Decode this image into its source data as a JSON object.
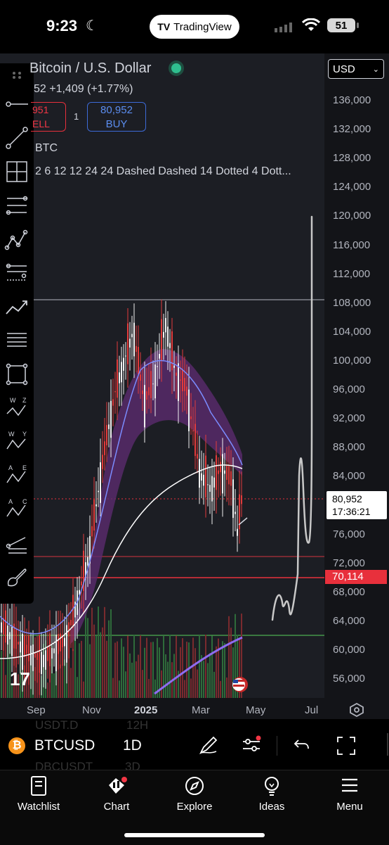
{
  "status_bar": {
    "time": "9:23",
    "app_pill": "TradingView",
    "battery": "51"
  },
  "legend": {
    "title": "Bitcoin / U.S. Dollar",
    "change": "52  +1,409 (+1.77%)",
    "sell_price": "951",
    "sell_label": "ELL",
    "spread": "1",
    "buy_price": "80,952",
    "buy_label": "BUY",
    "volume_label": "BTC",
    "indicators": "2 6 12 12 24 24 Dashed Dashed 14 Dotted 4 Dott..."
  },
  "axis": {
    "currency": "USD",
    "price_ticks": [
      "136,000",
      "132,000",
      "128,000",
      "124,000",
      "120,000",
      "116,000",
      "112,000",
      "108,000",
      "104,000",
      "100,000",
      "96,000",
      "92,000",
      "88,000",
      "84,000",
      "76,000",
      "72,000",
      "68,000",
      "64,000",
      "60,000",
      "56,000"
    ],
    "last_price": "80,952",
    "countdown": "17:36:21",
    "level_price": "70,114",
    "time_ticks": [
      "Sep",
      "Nov",
      "2025",
      "Mar",
      "May",
      "Jul"
    ]
  },
  "symbol_bar": {
    "symbol": "BTCUSD",
    "interval": "1D",
    "ghost_symbol_1": "USDT.D",
    "ghost_interval_1": "12H",
    "ghost_symbol_2": "DBCUSDT",
    "ghost_interval_2": "3D"
  },
  "tabs": [
    {
      "label": "Watchlist",
      "icon": "book-icon"
    },
    {
      "label": "Chart",
      "icon": "candles-icon"
    },
    {
      "label": "Explore",
      "icon": "compass-icon"
    },
    {
      "label": "Ideas",
      "icon": "bulb-icon"
    },
    {
      "label": "Menu",
      "icon": "hamburger-icon"
    }
  ],
  "colors": {
    "accent": "#2962ff",
    "sell": "#f23645",
    "buy": "#5b8def",
    "level": "#e8303c",
    "background": "#1c1e24"
  }
}
